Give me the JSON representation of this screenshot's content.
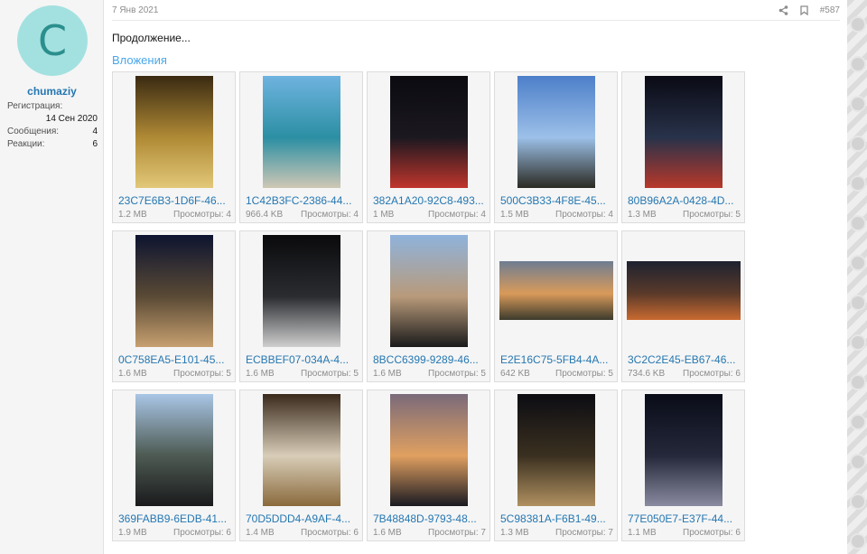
{
  "user": {
    "avatar_letter": "C",
    "name": "chumaziy",
    "reg_label": "Регистрация:",
    "reg_date": "14 Сен 2020",
    "stats": [
      {
        "label": "Сообщения:",
        "value": "4"
      },
      {
        "label": "Реакции:",
        "value": "6"
      }
    ]
  },
  "post": {
    "date": "7 Янв 2021",
    "number": "#587",
    "text": "Продолжение...",
    "attachments_title": "Вложения"
  },
  "attachments": [
    {
      "name": "23C7E6B3-1D6F-46...",
      "size": "1.2 MB",
      "views": "Просмотры: 4",
      "shape": "portrait",
      "palette": [
        "#3a2a12",
        "#b08a35",
        "#e2c879"
      ]
    },
    {
      "name": "1C42B3FC-2386-44...",
      "size": "966.4 KB",
      "views": "Просмотры: 4",
      "shape": "portrait",
      "palette": [
        "#6fb3e0",
        "#2b8fa3",
        "#cfc7b5"
      ]
    },
    {
      "name": "382A1A20-92C8-493...",
      "size": "1 MB",
      "views": "Просмотры: 4",
      "shape": "portrait",
      "palette": [
        "#0b0b10",
        "#1c1820",
        "#c0352c"
      ]
    },
    {
      "name": "500C3B33-4F8E-45...",
      "size": "1.5 MB",
      "views": "Просмотры: 4",
      "shape": "portrait",
      "palette": [
        "#4d7fc9",
        "#9cc0e8",
        "#2a2a22"
      ]
    },
    {
      "name": "80B96A2A-0428-4D...",
      "size": "1.3 MB",
      "views": "Просмотры: 5",
      "shape": "portrait",
      "palette": [
        "#0a0a14",
        "#28324a",
        "#b8382a"
      ]
    },
    {
      "name": "0C758EA5-E101-45...",
      "size": "1.6 MB",
      "views": "Просмотры: 5",
      "shape": "portrait",
      "palette": [
        "#0d1430",
        "#5a4a35",
        "#c7a070"
      ]
    },
    {
      "name": "ECBBEF07-034A-4...",
      "size": "1.6 MB",
      "views": "Просмотры: 5",
      "shape": "portrait",
      "palette": [
        "#0a0a0c",
        "#2a2c30",
        "#cfcfcf"
      ]
    },
    {
      "name": "8BCC6399-9289-46...",
      "size": "1.6 MB",
      "views": "Просмотры: 5",
      "shape": "portrait",
      "palette": [
        "#8fb3dc",
        "#b89a7a",
        "#1a1a1a"
      ]
    },
    {
      "name": "E2E16C75-5FB4-4A...",
      "size": "642 KB",
      "views": "Просмотры: 5",
      "shape": "landscape",
      "palette": [
        "#6f7d92",
        "#d99a5a",
        "#3c3a2c"
      ]
    },
    {
      "name": "3C2C2E45-EB67-46...",
      "size": "734.6 KB",
      "views": "Просмотры: 6",
      "shape": "landscape",
      "palette": [
        "#1e2230",
        "#5a3a2a",
        "#c96a30"
      ]
    },
    {
      "name": "369FABB9-6EDB-41...",
      "size": "1.9 MB",
      "views": "Просмотры: 6",
      "shape": "portrait",
      "palette": [
        "#a9c6e6",
        "#4d5a52",
        "#1a1a1c"
      ]
    },
    {
      "name": "70D5DDD4-A9AF-4...",
      "size": "1.4 MB",
      "views": "Просмотры: 6",
      "shape": "portrait",
      "palette": [
        "#3a2a1c",
        "#d8cdb8",
        "#8a6a3c"
      ]
    },
    {
      "name": "7B48848D-9793-48...",
      "size": "1.6 MB",
      "views": "Просмотры: 7",
      "shape": "portrait",
      "palette": [
        "#7a6a7a",
        "#e0a060",
        "#1a1a22"
      ]
    },
    {
      "name": "5C98381A-F6B1-49...",
      "size": "1.3 MB",
      "views": "Просмотры: 7",
      "shape": "portrait",
      "palette": [
        "#0c0c12",
        "#3a3020",
        "#b09060"
      ]
    },
    {
      "name": "77E050E7-E37F-44...",
      "size": "1.1 MB",
      "views": "Просмотры: 6",
      "shape": "portrait",
      "palette": [
        "#0a0c18",
        "#24283a",
        "#8a8aa0"
      ]
    }
  ]
}
